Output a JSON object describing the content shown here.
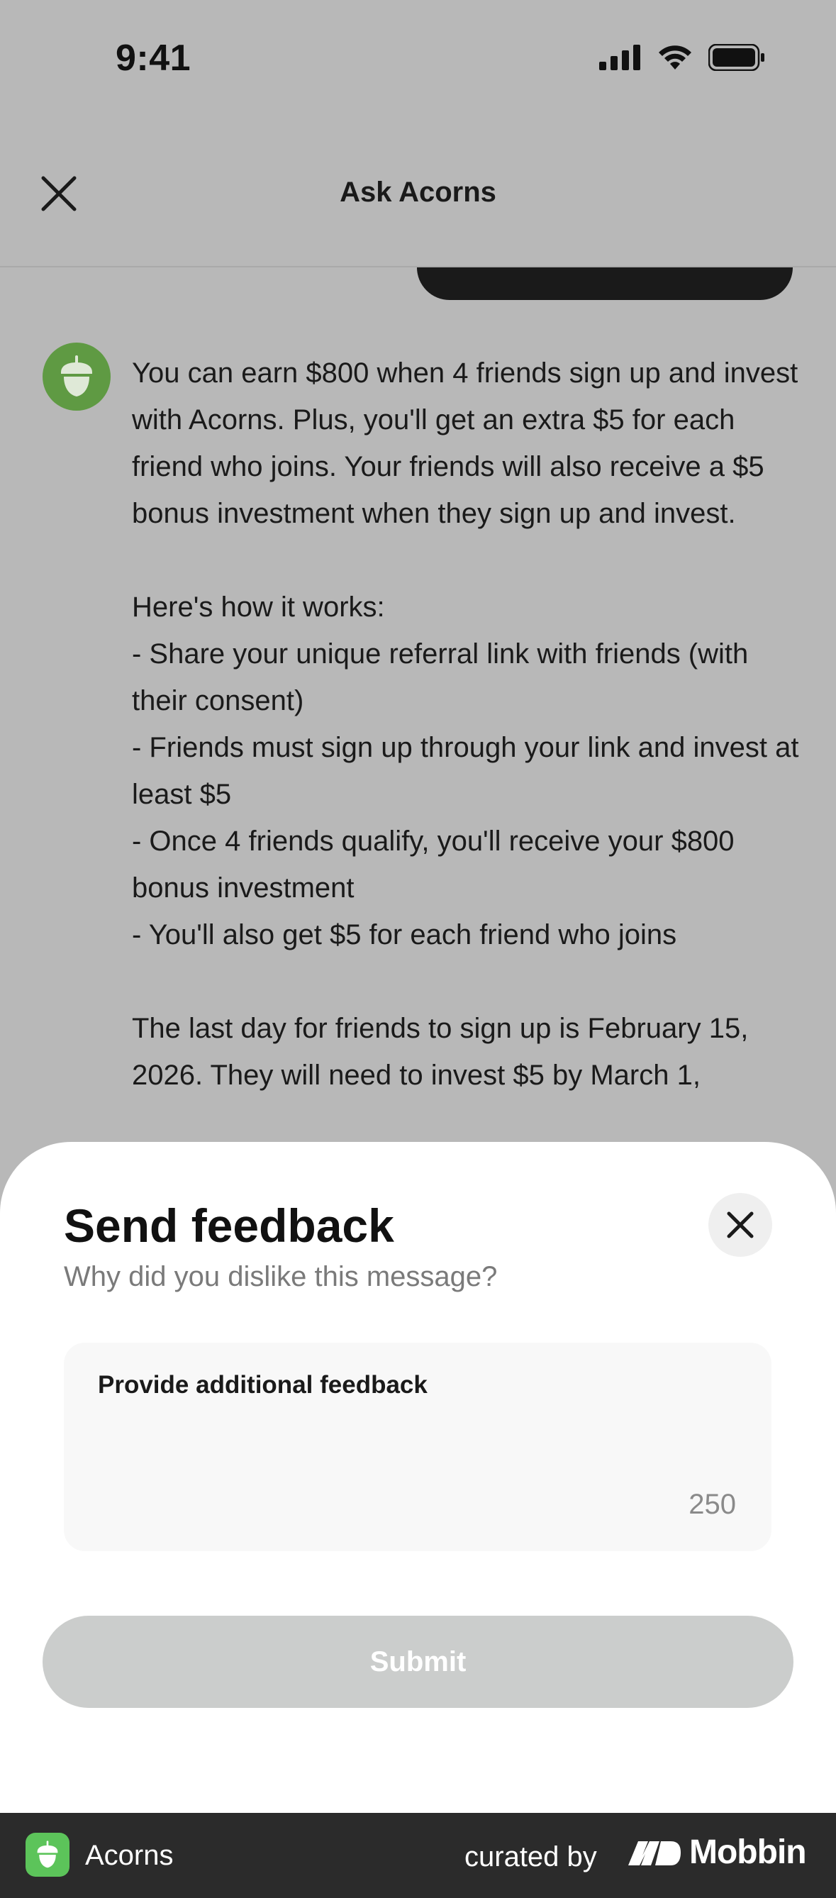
{
  "status_bar": {
    "time": "9:41"
  },
  "header": {
    "title": "Ask Acorns"
  },
  "chat": {
    "bot_message_lines": [
      "You can earn $800 when 4 friends sign up and invest with Acorns. Plus, you'll get an extra $5 for each friend who joins. Your friends will also receive a $5 bonus investment when they sign up and invest.",
      "",
      "Here's how it works:",
      "- Share your unique referral link with friends (with their consent)",
      "- Friends must sign up through your link and invest at least $5",
      "- Once 4 friends qualify, you'll receive your $800 bonus investment",
      "- You'll also get $5 for each friend who joins",
      "",
      "The last day for friends to sign up is February 15, 2026. They will need to invest $5 by March 1,"
    ]
  },
  "sheet": {
    "title": "Send feedback",
    "subtitle": "Why did you dislike this message?",
    "feedback_label": "Provide additional feedback",
    "feedback_value": "",
    "char_counter": "250",
    "submit_label": "Submit"
  },
  "footer": {
    "app_name": "Acorns",
    "curated_by": "curated by",
    "brand_name": "Mobbin"
  },
  "colors": {
    "overlay_background": "#b8b8b8",
    "acorns_green": "#5f9a43",
    "submit_disabled": "#cbcdcc",
    "footer_background": "#2b2b2b"
  }
}
